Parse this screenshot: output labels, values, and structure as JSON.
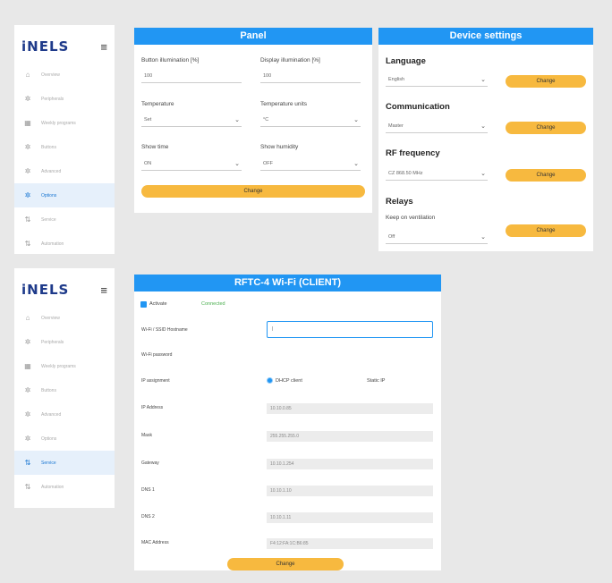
{
  "app": {
    "logo": "iNELS",
    "menu_icon": "≡"
  },
  "sidebar_top": {
    "items": [
      {
        "icon": "home-icon",
        "glyph": "⌂",
        "label": "Overview"
      },
      {
        "icon": "gear-icon",
        "glyph": "✲",
        "label": "Peripherals"
      },
      {
        "icon": "calendar-icon",
        "glyph": "▦",
        "label": "Weekly programs"
      },
      {
        "icon": "gear-icon",
        "glyph": "✲",
        "label": "Buttons"
      },
      {
        "icon": "gear-icon",
        "glyph": "✲",
        "label": "Advanced"
      },
      {
        "icon": "gear-icon",
        "glyph": "✲",
        "label": "Options"
      },
      {
        "icon": "service-icon",
        "glyph": "⇅",
        "label": "Service"
      },
      {
        "icon": "service-icon",
        "glyph": "⇅",
        "label": "Automation"
      }
    ],
    "active_index": 5
  },
  "sidebar_bottom": {
    "items": [
      {
        "icon": "home-icon",
        "glyph": "⌂",
        "label": "Overview"
      },
      {
        "icon": "gear-icon",
        "glyph": "✲",
        "label": "Peripherals"
      },
      {
        "icon": "calendar-icon",
        "glyph": "▦",
        "label": "Weekly programs"
      },
      {
        "icon": "gear-icon",
        "glyph": "✲",
        "label": "Buttons"
      },
      {
        "icon": "gear-icon",
        "glyph": "✲",
        "label": "Advanced"
      },
      {
        "icon": "gear-icon",
        "glyph": "✲",
        "label": "Options"
      },
      {
        "icon": "service-icon",
        "glyph": "⇅",
        "label": "Service"
      },
      {
        "icon": "service-icon",
        "glyph": "⇅",
        "label": "Automation"
      }
    ],
    "active_index": 6
  },
  "panel": {
    "title": "Panel",
    "button_illumination_label": "Button illumination [%]",
    "button_illumination_value": "100",
    "display_illumination_label": "Display illumination [%]",
    "display_illumination_value": "100",
    "temperature_label": "Temperature",
    "temperature_value": "Set",
    "temperature_units_label": "Temperature units",
    "temperature_units_value": "°C",
    "show_time_label": "Show time",
    "show_time_value": "ON",
    "show_humidity_label": "Show humidity",
    "show_humidity_value": "OFF",
    "change_label": "Change"
  },
  "device": {
    "title": "Device settings",
    "language_heading": "Language",
    "language_value": "English",
    "communication_heading": "Communication",
    "communication_value": "Master",
    "rf_heading": "RF frequency",
    "rf_value": "CZ 868.50 MHz",
    "relays_heading": "Relays",
    "keep_label": "Keep on ventilation",
    "keep_value": "Off",
    "change_label": "Change"
  },
  "wifi": {
    "title": "RFTC-4 Wi-Fi (CLIENT)",
    "activate_label": "Activate",
    "status": "Connected",
    "ssid_label": "Wi-Fi / SSID Hostname",
    "ssid_value": "|",
    "password_label": "Wi-Fi password",
    "ip_assign_label": "IP assignment",
    "dhcp_label": "DHCP client",
    "static_label": "Static IP",
    "ip_label": "IP Address",
    "ip_value": "10.10.0.85",
    "mask_label": "Mask",
    "mask_value": "255.255.255.0",
    "gateway_label": "Gateway",
    "gateway_value": "10.10.1.254",
    "dns1_label": "DNS 1",
    "dns1_value": "10.10.1.10",
    "dns2_label": "DNS 2",
    "dns2_value": "10.10.1.11",
    "mac_label": "MAC Address",
    "mac_value": "F4:12:FA:1C:B6:85",
    "change_label": "Change"
  },
  "colors": {
    "accent": "#2196f3",
    "button": "#f7b93f",
    "active_bg": "#e6f0fb"
  }
}
